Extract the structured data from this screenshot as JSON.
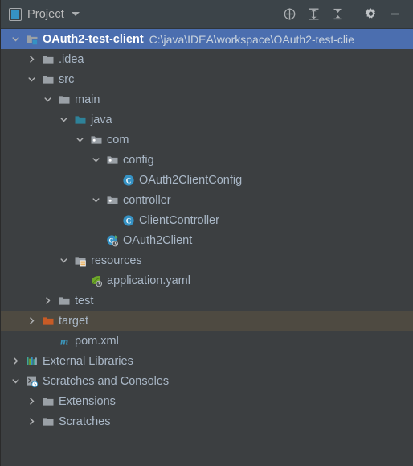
{
  "toolbar": {
    "title": "Project",
    "dropdown_icon": "chevron-down-icon",
    "actions": [
      {
        "name": "select-opened-file-button",
        "icon": "crosshair-target-icon",
        "tooltip": "Select Opened File"
      },
      {
        "name": "expand-all-button",
        "icon": "expand-all-icon",
        "tooltip": "Expand All"
      },
      {
        "name": "collapse-all-button",
        "icon": "collapse-all-icon",
        "tooltip": "Collapse All"
      },
      {
        "name": "settings-button",
        "icon": "gear-icon",
        "tooltip": "Settings"
      },
      {
        "name": "hide-button",
        "icon": "minimize-icon",
        "tooltip": "Hide"
      }
    ]
  },
  "colors": {
    "toolbar_bg": "#3C4449",
    "panel_bg": "#3C3F41",
    "selection_bg": "#4B6EAF",
    "hover_bg": "#4E4A41",
    "text": "#A9B7C6",
    "accent_blue": "#3592C4",
    "source_root": "#2E8299",
    "excluded_orange": "#C75B26",
    "class_icon": "#3592C4",
    "maven_icon": "#3C99BF",
    "spring_green": "#6FA82A"
  },
  "tree": {
    "rows": [
      {
        "label": "OAuth2-test-client",
        "suffix": "C:\\java\\IDEA\\workspace\\OAuth2-test-clie",
        "depth": 0,
        "twisty": "expanded",
        "icon": "module-folder-icon",
        "state": "selected",
        "bold": true
      },
      {
        "label": ".idea",
        "suffix": "",
        "depth": 1,
        "twisty": "collapsed",
        "icon": "folder-icon",
        "state": "normal",
        "bold": false
      },
      {
        "label": "src",
        "suffix": "",
        "depth": 1,
        "twisty": "expanded",
        "icon": "folder-icon",
        "state": "normal",
        "bold": false
      },
      {
        "label": "main",
        "suffix": "",
        "depth": 2,
        "twisty": "expanded",
        "icon": "folder-icon",
        "state": "normal",
        "bold": false
      },
      {
        "label": "java",
        "suffix": "",
        "depth": 3,
        "twisty": "expanded",
        "icon": "source-root-folder-icon",
        "state": "normal",
        "bold": false
      },
      {
        "label": "com",
        "suffix": "",
        "depth": 4,
        "twisty": "expanded",
        "icon": "package-folder-icon",
        "state": "normal",
        "bold": false
      },
      {
        "label": "config",
        "suffix": "",
        "depth": 5,
        "twisty": "expanded",
        "icon": "package-folder-icon",
        "state": "normal",
        "bold": false
      },
      {
        "label": "OAuth2ClientConfig",
        "suffix": "",
        "depth": 6,
        "twisty": "none",
        "icon": "java-class-icon",
        "state": "normal",
        "bold": false
      },
      {
        "label": "controller",
        "suffix": "",
        "depth": 5,
        "twisty": "expanded",
        "icon": "package-folder-icon",
        "state": "normal",
        "bold": false
      },
      {
        "label": "ClientController",
        "suffix": "",
        "depth": 6,
        "twisty": "none",
        "icon": "java-class-icon",
        "state": "normal",
        "bold": false
      },
      {
        "label": "OAuth2Client",
        "suffix": "",
        "depth": 5,
        "twisty": "none",
        "icon": "spring-boot-run-class-icon",
        "state": "normal",
        "bold": false
      },
      {
        "label": "resources",
        "suffix": "",
        "depth": 3,
        "twisty": "expanded",
        "icon": "resources-root-folder-icon",
        "state": "normal",
        "bold": false
      },
      {
        "label": "application.yaml",
        "suffix": "",
        "depth": 4,
        "twisty": "none",
        "icon": "spring-yaml-file-icon",
        "state": "normal",
        "bold": false
      },
      {
        "label": "test",
        "suffix": "",
        "depth": 2,
        "twisty": "collapsed",
        "icon": "folder-icon",
        "state": "normal",
        "bold": false
      },
      {
        "label": "target",
        "suffix": "",
        "depth": 1,
        "twisty": "collapsed",
        "icon": "excluded-folder-icon",
        "state": "hovered",
        "bold": false
      },
      {
        "label": "pom.xml",
        "suffix": "",
        "depth": 2,
        "twisty": "none",
        "icon": "maven-pom-icon",
        "state": "normal",
        "bold": false
      },
      {
        "label": "External Libraries",
        "suffix": "",
        "depth": 0,
        "twisty": "collapsed",
        "icon": "libraries-icon",
        "state": "normal",
        "bold": false
      },
      {
        "label": "Scratches and Consoles",
        "suffix": "",
        "depth": 0,
        "twisty": "expanded",
        "icon": "scratches-console-icon",
        "state": "normal",
        "bold": false
      },
      {
        "label": "Extensions",
        "suffix": "",
        "depth": 1,
        "twisty": "collapsed",
        "icon": "folder-icon",
        "state": "normal",
        "bold": false
      },
      {
        "label": "Scratches",
        "suffix": "",
        "depth": 1,
        "twisty": "collapsed",
        "icon": "folder-icon",
        "state": "normal",
        "bold": false
      }
    ]
  }
}
